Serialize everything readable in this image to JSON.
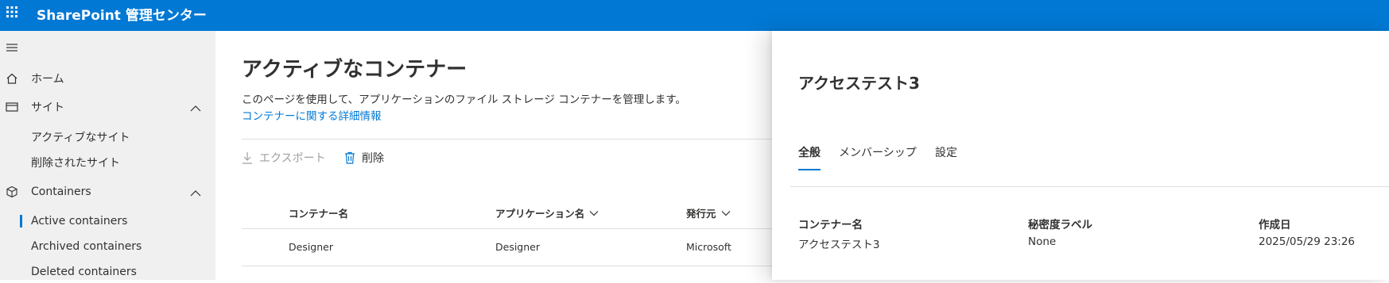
{
  "app": {
    "title": "SharePoint 管理センター"
  },
  "nav": {
    "home": "ホーム",
    "sites": "サイト",
    "sites_sub": [
      "アクティブなサイト",
      "削除されたサイト"
    ],
    "containers": "Containers",
    "containers_sub": [
      "Active containers",
      "Archived containers",
      "Deleted containers"
    ],
    "active_item": "Active containers"
  },
  "main": {
    "title": "アクティブなコンテナー",
    "description": "このページを使用して、アプリケーションのファイル ストレージ コンテナーを管理します。",
    "link": "コンテナーに関する詳細情報",
    "commands": {
      "export": "エクスポート",
      "delete": "削除"
    },
    "columns": [
      "コンテナー名",
      "アプリケーション名",
      "発行元"
    ],
    "rows": [
      [
        "Designer",
        "Designer",
        "Microsoft"
      ]
    ]
  },
  "panel": {
    "title": "アクセステスト3",
    "tabs": [
      "全般",
      "メンバーシップ",
      "設定"
    ],
    "active_tab": "全般",
    "fields": [
      {
        "label": "コンテナー名",
        "value": "アクセステスト3"
      },
      {
        "label": "秘密度ラベル",
        "value": "None"
      },
      {
        "label": "作成日",
        "value": "2025/05/29 23:26"
      }
    ]
  },
  "colors": {
    "brand": "#0078d4",
    "sidebar_bg": "#f0f0f0",
    "text": "#323130",
    "disabled": "#a19f9d"
  }
}
